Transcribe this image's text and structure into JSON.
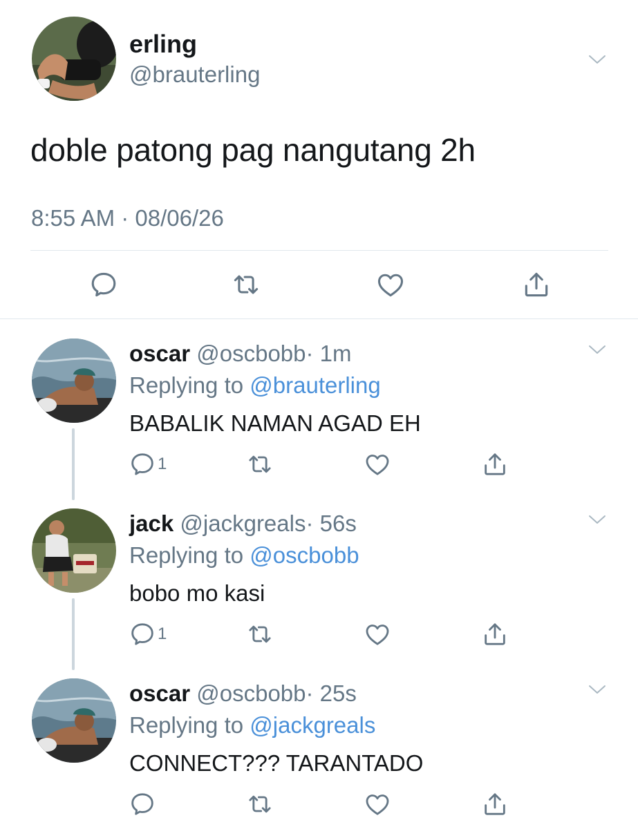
{
  "main_tweet": {
    "display_name": "erling",
    "handle": "@brauterling",
    "text": "doble patong pag nangutang 2h",
    "timestamp": "8:55 AM · 08/06/26"
  },
  "replies": [
    {
      "display_name": "oscar",
      "handle": "@oscbobb",
      "time": "· 1m",
      "replying_prefix": "Replying to",
      "replying_to": "@brauterling",
      "text": "BABALIK NAMAN AGAD EH",
      "reply_count": "1"
    },
    {
      "display_name": "jack",
      "handle": "@jackgreals",
      "time": "· 56s",
      "replying_prefix": "Replying to",
      "replying_to": "@oscbobb",
      "text": "bobo mo kasi",
      "reply_count": "1"
    },
    {
      "display_name": "oscar",
      "handle": "@oscbobb",
      "time": "· 25s",
      "replying_prefix": "Replying to",
      "replying_to": "@jackgreals",
      "text": "CONNECT??? TARANTADO",
      "reply_count": ""
    }
  ],
  "colors": {
    "text": "#14171a",
    "secondary": "#657786",
    "link": "#4a90d9",
    "divider": "#e1e8ed",
    "thread_line": "#ccd6dd"
  },
  "icons": [
    "reply-icon",
    "retweet-icon",
    "like-icon",
    "share-icon",
    "chevron-down-icon"
  ]
}
